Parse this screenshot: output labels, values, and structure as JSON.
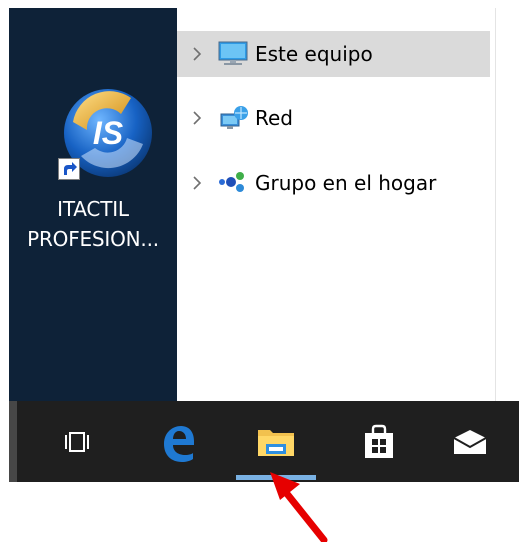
{
  "desktop": {
    "icon_label_line1": "ITACTIL",
    "icon_label_line2": "PROFESION...",
    "icon_badge": "IS"
  },
  "navigation_pane": {
    "items": [
      {
        "label": "Este equipo",
        "icon": "computer-icon",
        "selected": true
      },
      {
        "label": "Red",
        "icon": "network-icon",
        "selected": false
      },
      {
        "label": "Grupo en el hogar",
        "icon": "homegroup-icon",
        "selected": false
      }
    ]
  },
  "taskbar": {
    "buttons": [
      {
        "name": "task-view",
        "icon": "task-view-icon"
      },
      {
        "name": "edge",
        "icon": "edge-icon"
      },
      {
        "name": "file-explorer",
        "icon": "file-explorer-icon",
        "active": true
      },
      {
        "name": "store",
        "icon": "store-icon"
      },
      {
        "name": "mail",
        "icon": "mail-icon"
      }
    ]
  },
  "colors": {
    "desktop_bg": "#0e2238",
    "taskbar_bg": "#1f1f1f",
    "selected_row": "#dadada",
    "active_indicator": "#79b1e3",
    "annotation_arrow": "#e60000",
    "edge_blue": "#1f79d2"
  }
}
